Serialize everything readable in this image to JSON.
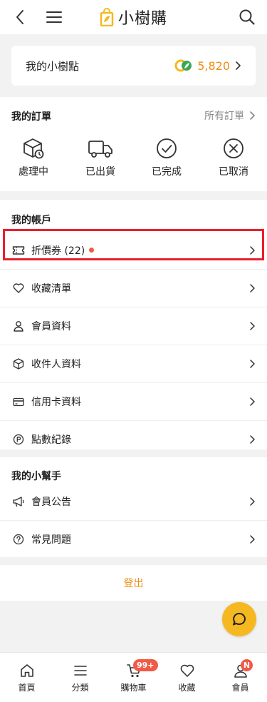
{
  "header": {
    "logo_text": "小樹購"
  },
  "points": {
    "title": "我的小樹點",
    "value": "5,820"
  },
  "orders": {
    "title": "我的訂單",
    "all_label": "所有訂單",
    "items": [
      {
        "label": "處理中",
        "icon": "box-clock-icon"
      },
      {
        "label": "已出貨",
        "icon": "truck-icon"
      },
      {
        "label": "已完成",
        "icon": "check-circle-icon"
      },
      {
        "label": "已取消",
        "icon": "x-circle-icon"
      }
    ]
  },
  "account": {
    "title": "我的帳戶",
    "items": [
      {
        "label": "折價券 (22)",
        "icon": "ticket-icon"
      },
      {
        "label": "收藏清單",
        "icon": "heart-icon"
      },
      {
        "label": "會員資料",
        "icon": "user-icon"
      },
      {
        "label": "收件人資料",
        "icon": "package-icon"
      },
      {
        "label": "信用卡資料",
        "icon": "credit-card-icon"
      },
      {
        "label": "點數紀錄",
        "icon": "p-coin-icon"
      }
    ]
  },
  "helper": {
    "title": "我的小幫手",
    "items": [
      {
        "label": "會員公告",
        "icon": "megaphone-icon"
      },
      {
        "label": "常見問題",
        "icon": "question-circle-icon"
      }
    ]
  },
  "logout_label": "登出",
  "bottom_nav": {
    "items": [
      {
        "label": "首頁",
        "icon": "home-icon"
      },
      {
        "label": "分類",
        "icon": "list-icon"
      },
      {
        "label": "購物車",
        "icon": "cart-icon",
        "badge": "99+"
      },
      {
        "label": "收藏",
        "icon": "heart-icon"
      },
      {
        "label": "會員",
        "icon": "member-icon",
        "badge": "N"
      }
    ]
  },
  "colors": {
    "accent": "#f08c12",
    "badge": "#f05a46",
    "highlight": "#e8202a",
    "fab": "#f6b820"
  }
}
